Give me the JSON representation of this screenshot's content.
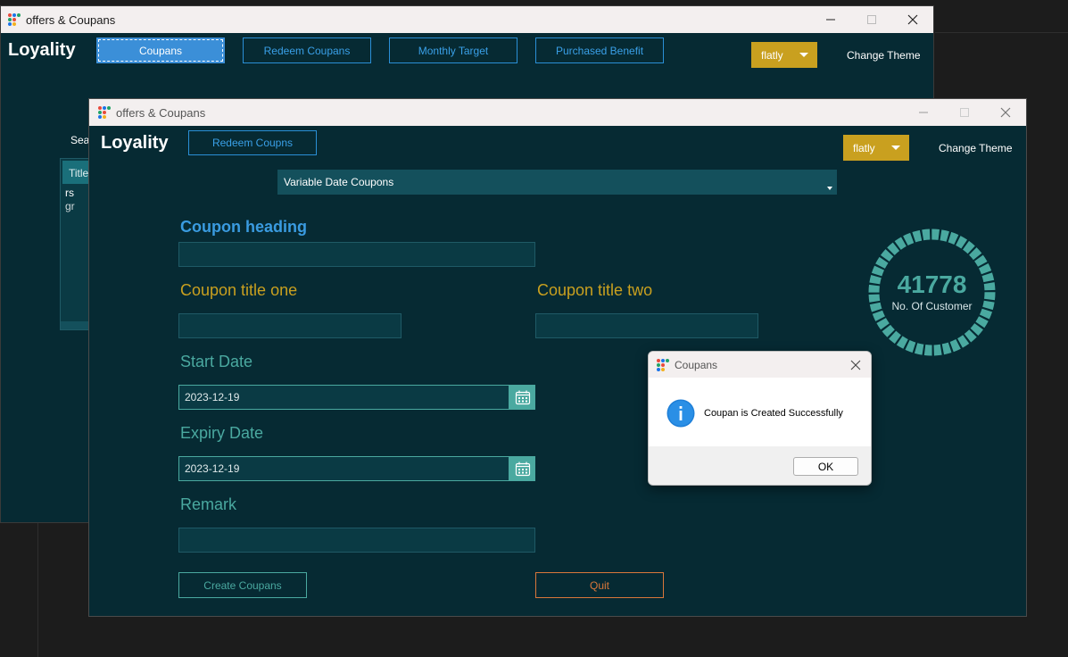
{
  "colors": {
    "app_bg": "#062a33",
    "accent_blue": "#3aa0e8",
    "theme_gold": "#c9a01f",
    "teal": "#4aa9a0",
    "quit_orange": "#d9773a"
  },
  "back_window": {
    "title": "offers & Coupans",
    "brand": "Loyality",
    "nav": [
      "Coupans",
      "Redeem Coupans",
      "Monthly Target",
      "Purchased Benefit"
    ],
    "active_nav": "Coupans",
    "theme_button": "flatly",
    "change_theme": "Change Theme",
    "search_label": "Sear",
    "table": {
      "header": "Title",
      "rows": [
        "rs",
        "gr"
      ]
    }
  },
  "front_window": {
    "title": "offers & Coupans",
    "brand": "Loyality",
    "redeem_button": "Redeem Coupns",
    "theme_button": "flatly",
    "change_theme": "Change Theme",
    "coupon_type": "Variable Date Coupons",
    "labels": {
      "heading": "Coupon heading",
      "title_one": "Coupon title one",
      "title_two": "Coupon title two",
      "start_date": "Start Date",
      "expiry_date": "Expiry Date",
      "remark": "Remark"
    },
    "values": {
      "heading": "",
      "title_one": "",
      "title_two": "",
      "start_date": "2023-12-19",
      "expiry_date": "2023-12-19",
      "remark": ""
    },
    "meter": {
      "value": "41778",
      "label": "No. Of Customer"
    },
    "create_button": "Create Coupans",
    "quit_button": "Quit"
  },
  "dialog": {
    "title": "Coupans",
    "message": "Coupan is Created Successfully",
    "ok": "OK",
    "icon": "info-icon"
  }
}
